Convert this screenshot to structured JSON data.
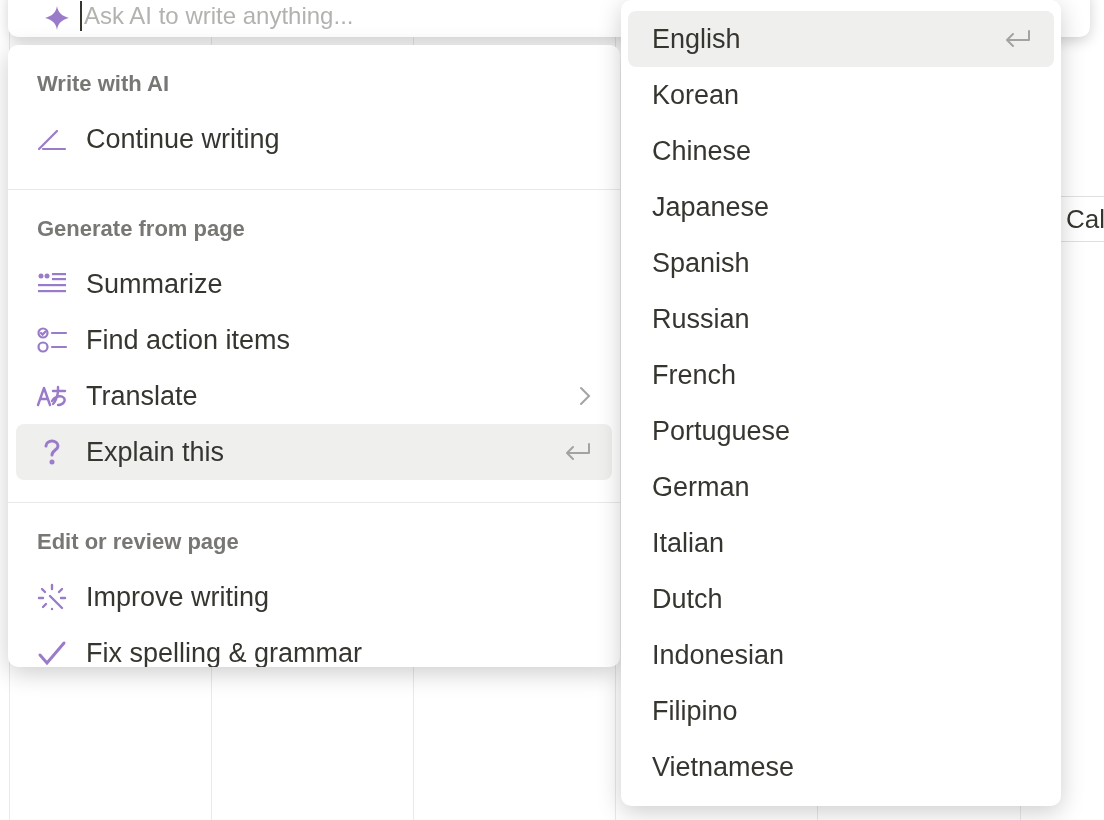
{
  "ai_prompt": {
    "placeholder": "Ask AI to write anything..."
  },
  "background": {
    "view_tab": "Cal"
  },
  "ai_menu": {
    "sections": [
      {
        "title": "Write with AI",
        "items": [
          {
            "label": "Continue writing",
            "kind": "pen",
            "selected": false
          }
        ]
      },
      {
        "title": "Generate from page",
        "items": [
          {
            "label": "Summarize",
            "kind": "summary",
            "selected": false
          },
          {
            "label": "Find action items",
            "kind": "checklist",
            "selected": false
          },
          {
            "label": "Translate",
            "kind": "translate",
            "submenu": true,
            "selected": false
          },
          {
            "label": "Explain this",
            "kind": "question",
            "selected": true
          }
        ]
      },
      {
        "title": "Edit or review page",
        "items": [
          {
            "label": "Improve writing",
            "kind": "sparkle",
            "selected": false
          },
          {
            "label": "Fix spelling & grammar",
            "kind": "check",
            "selected": false
          }
        ]
      }
    ]
  },
  "language_menu": {
    "items": [
      {
        "label": "English",
        "selected": true
      },
      {
        "label": "Korean",
        "selected": false
      },
      {
        "label": "Chinese",
        "selected": false
      },
      {
        "label": "Japanese",
        "selected": false
      },
      {
        "label": "Spanish",
        "selected": false
      },
      {
        "label": "Russian",
        "selected": false
      },
      {
        "label": "French",
        "selected": false
      },
      {
        "label": "Portuguese",
        "selected": false
      },
      {
        "label": "German",
        "selected": false
      },
      {
        "label": "Italian",
        "selected": false
      },
      {
        "label": "Dutch",
        "selected": false
      },
      {
        "label": "Indonesian",
        "selected": false
      },
      {
        "label": "Filipino",
        "selected": false
      },
      {
        "label": "Vietnamese",
        "selected": false
      }
    ]
  }
}
